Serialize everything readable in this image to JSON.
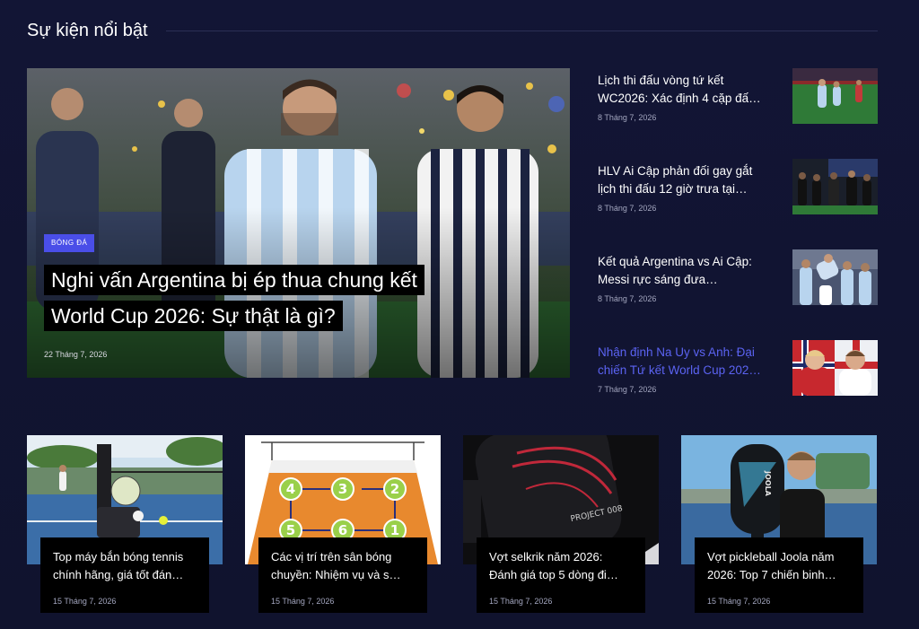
{
  "section": {
    "title": "Sự kiện nổi bật"
  },
  "featured": {
    "category": "BÓNG ĐÁ",
    "title": "Nghi vấn Argentina bị ép thua chung kết World Cup 2026: Sự thật là gì?",
    "date": "22 Tháng 7, 2026"
  },
  "side_articles": [
    {
      "title": "Lịch thi đấu vòng tứ kết WC2026: Xác định 4 cặp đấ…",
      "date": "8 Tháng 7, 2026"
    },
    {
      "title": "HLV Ai Cập phản đối gay gắt lịch thi đấu 12 giờ trưa tại…",
      "date": "8 Tháng 7, 2026"
    },
    {
      "title": "Kết quả Argentina vs Ai Cập: Messi rực sáng đưa…",
      "date": "8 Tháng 7, 2026"
    },
    {
      "title": "Nhận định Na Uy vs Anh: Đại chiến Tứ kết World Cup 202…",
      "date": "7 Tháng 7, 2026"
    }
  ],
  "cards": [
    {
      "title": "Top máy bắn bóng tennis chính hãng, giá tốt đán…",
      "date": "15 Tháng 7, 2026"
    },
    {
      "title": "Các vị trí trên sân bóng chuyền: Nhiệm vụ và s…",
      "date": "15 Tháng 7, 2026"
    },
    {
      "title": "Vợt selkrik năm 2026: Đánh giá top 5 dòng đi…",
      "date": "15 Tháng 7, 2026"
    },
    {
      "title": "Vợt pickleball Joola năm 2026: Top 7 chiến binh…",
      "date": "15 Tháng 7, 2026"
    }
  ],
  "graphics": {
    "court_positions": [
      "4",
      "3",
      "2",
      "5",
      "6",
      "1"
    ],
    "paddle_text_1": "PROJECT 008",
    "paddle_brand_2": "JOOLA",
    "colors": {
      "accent": "#4a4ee8",
      "active_link": "#5b63f2",
      "background": "#121535"
    }
  }
}
